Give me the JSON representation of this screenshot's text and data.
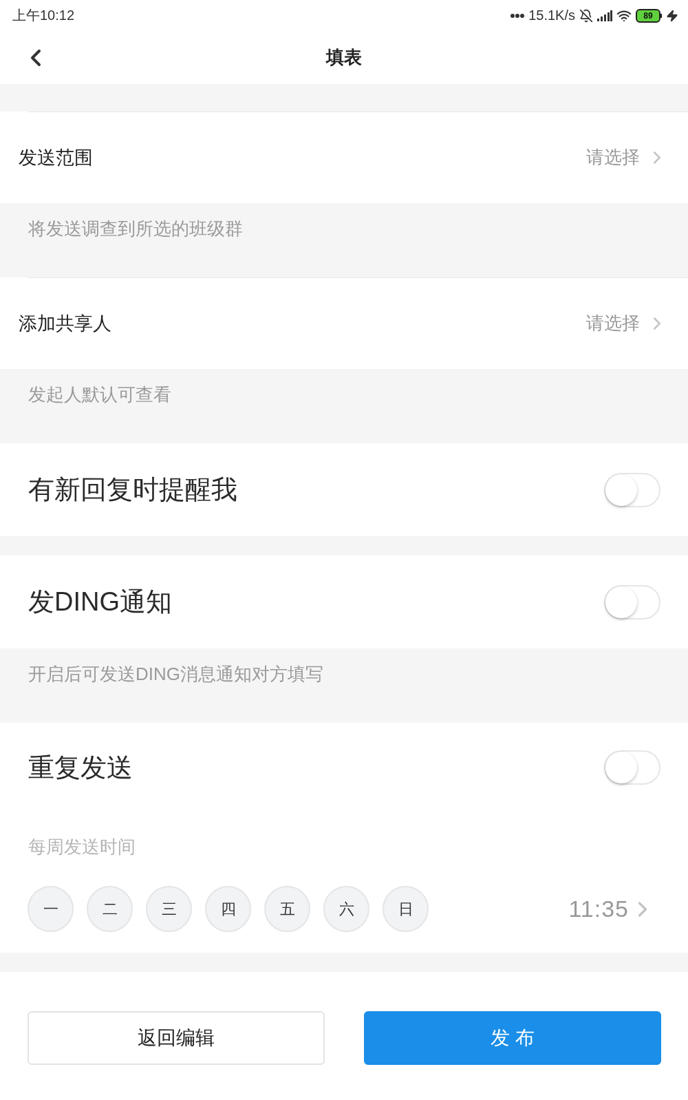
{
  "status_bar": {
    "time": "上午10:12",
    "network_speed": "15.1K/s",
    "battery": "89"
  },
  "header": {
    "title": "填表"
  },
  "items": [
    {
      "kind": "select",
      "label": "发送范围",
      "value": "请选择",
      "hint": "将发送调查到所选的班级群"
    },
    {
      "kind": "select",
      "label": "添加共享人",
      "value": "请选择",
      "hint": "发起人默认可查看"
    },
    {
      "kind": "toggle",
      "label": "有新回复时提醒我",
      "on": false
    },
    {
      "kind": "toggle",
      "label": "发DING通知",
      "on": false,
      "hint": "开启后可发送DING消息通知对方填写"
    },
    {
      "kind": "repeat",
      "label": "重复发送",
      "on": false,
      "schedule_label": "每周发送时间",
      "days": [
        {
          "label": "一",
          "selected": false
        },
        {
          "label": "二",
          "selected": false
        },
        {
          "label": "三",
          "selected": false
        },
        {
          "label": "四",
          "selected": false
        },
        {
          "label": "五",
          "selected": false
        },
        {
          "label": "六",
          "selected": false
        },
        {
          "label": "日",
          "selected": false
        }
      ],
      "time": "11:35"
    }
  ],
  "buttons": [
    {
      "label": "返回编辑",
      "kind": "secondary"
    },
    {
      "label": "发 布",
      "kind": "primary"
    }
  ]
}
